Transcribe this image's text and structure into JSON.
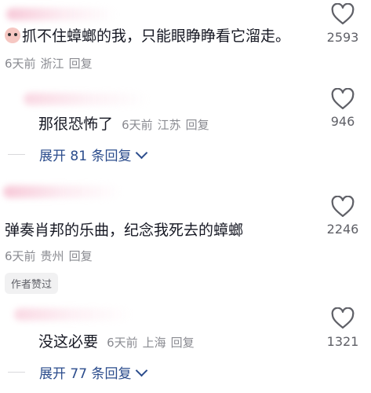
{
  "comments": [
    {
      "text": "抓不住蟑螂的我，只能眼睁睁看它溜走。",
      "emoji": "crying-face-emoji",
      "meta_time": "6天前",
      "meta_location": "浙江",
      "meta_reply": "回复",
      "likes": "2593"
    },
    {
      "text": "那很恐怖了",
      "meta_time": "6天前",
      "meta_location": "江苏",
      "meta_reply": "回复",
      "likes": "946"
    },
    {
      "text": "弹奏肖邦的乐曲，纪念我死去的蟑螂",
      "meta_time": "6天前",
      "meta_location": "贵州",
      "meta_reply": "回复",
      "likes": "2246",
      "badge": "作者赞过"
    },
    {
      "text": "没这必要",
      "meta_time": "6天前",
      "meta_location": "上海",
      "meta_reply": "回复",
      "likes": "1321"
    }
  ],
  "expand_1": "展开 81 条回复",
  "expand_2": "展开 77 条回复",
  "colors": {
    "link": "#2b4c8c",
    "meta": "#8a8b91",
    "text": "#161823"
  },
  "icons": [
    "heart-outline-icon",
    "chevron-down-icon"
  ]
}
